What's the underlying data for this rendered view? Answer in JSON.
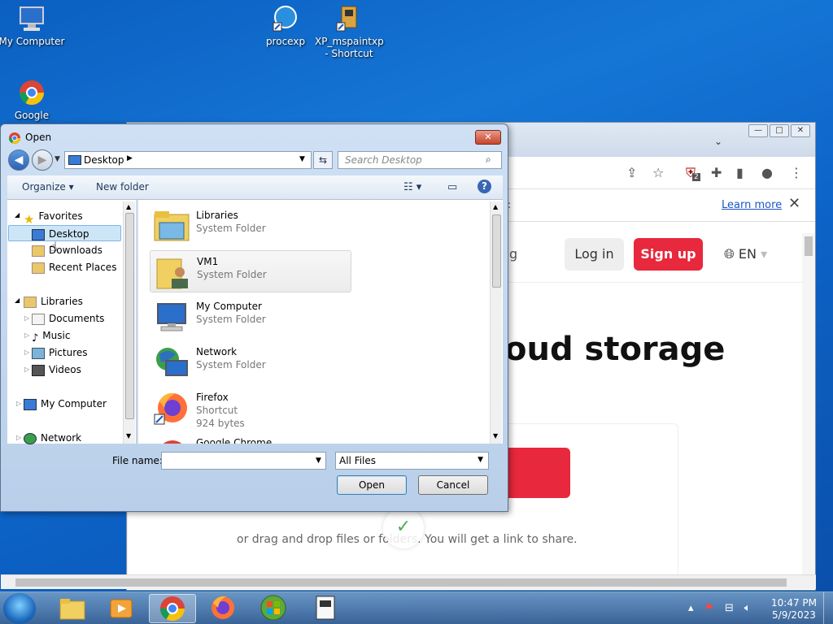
{
  "desktop": {
    "icons": [
      {
        "label": "My Computer"
      },
      {
        "label": "procexp"
      },
      {
        "label": "XP_mspaintxp - Shortcut"
      },
      {
        "label": "Google"
      }
    ]
  },
  "browser": {
    "notice": {
      "learn_more": "Learn more",
      "close": "✕"
    },
    "login": "Log in",
    "signup": "Sign up",
    "lang": "EN",
    "hero_text": "oud storage",
    "partial_nav": "g",
    "partial_notice": ":",
    "drop_text": "or drag and drop files or folders. You will get a link to share.",
    "extension_badge": "2"
  },
  "dialog": {
    "title": "Open",
    "address": "Desktop",
    "search_placeholder": "Search Desktop",
    "commands": {
      "organize": "Organize",
      "new_folder": "New folder"
    },
    "nav": {
      "favorites": "Favorites",
      "desktop": "Desktop",
      "downloads": "Downloads",
      "recent_places": "Recent Places",
      "libraries": "Libraries",
      "documents": "Documents",
      "music": "Music",
      "pictures": "Pictures",
      "videos": "Videos",
      "my_computer": "My Computer",
      "network": "Network"
    },
    "files": [
      {
        "name": "Libraries",
        "type": "System Folder",
        "size": ""
      },
      {
        "name": "VM1",
        "type": "System Folder",
        "size": ""
      },
      {
        "name": "My Computer",
        "type": "System Folder",
        "size": ""
      },
      {
        "name": "Network",
        "type": "System Folder",
        "size": ""
      },
      {
        "name": "Firefox",
        "type": "Shortcut",
        "size": "924 bytes"
      },
      {
        "name": "Google Chrome",
        "type": "",
        "size": ""
      }
    ],
    "file_name_label": "File name:",
    "file_name_value": "",
    "file_type": "All Files",
    "open_button": "Open",
    "cancel_button": "Cancel"
  },
  "taskbar": {
    "clock_time": "10:47 PM",
    "clock_date": "5/9/2023"
  },
  "colors": {
    "accent_red": "#e8283c",
    "desktop_blue": "#1576d6",
    "link_blue": "#1a56c4"
  }
}
